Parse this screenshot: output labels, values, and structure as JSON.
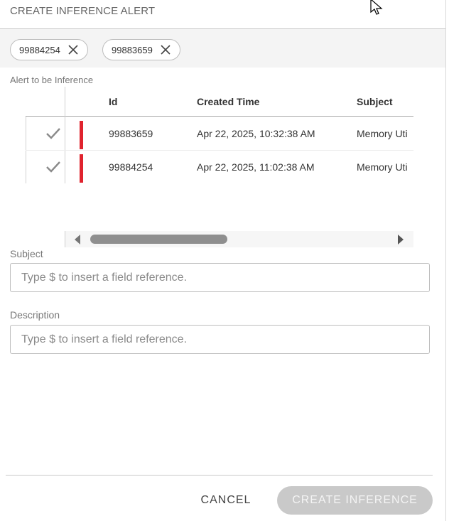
{
  "dialog": {
    "title": "CREATE INFERENCE ALERT"
  },
  "chips": [
    {
      "label": "99884254"
    },
    {
      "label": "99883659"
    }
  ],
  "section": {
    "label": "Alert to be Inference"
  },
  "table": {
    "columns": [
      "Id",
      "Created Time",
      "Subject"
    ],
    "rows": [
      {
        "id": "99883659",
        "created": "Apr 22, 2025, 10:32:38 AM",
        "subject": "Memory Uti",
        "selected": true,
        "severity_color": "#e0232e"
      },
      {
        "id": "99884254",
        "created": "Apr 22, 2025, 11:02:38 AM",
        "subject": "Memory Uti",
        "selected": true,
        "severity_color": "#e0232e"
      }
    ]
  },
  "form": {
    "subject_label": "Subject",
    "subject_placeholder": "Type $ to insert a field reference.",
    "subject_value": "",
    "description_label": "Description",
    "description_placeholder": "Type $ to insert a field reference.",
    "description_value": ""
  },
  "footer": {
    "cancel_label": "CANCEL",
    "create_label": "CREATE INFERENCE"
  },
  "icons": {
    "chip_close": "close-icon",
    "row_check": "check-icon",
    "cursor": "mouse-pointer-icon"
  },
  "colors": {
    "severity": "#e0232e",
    "disabled_button": "#c9c9c9"
  }
}
